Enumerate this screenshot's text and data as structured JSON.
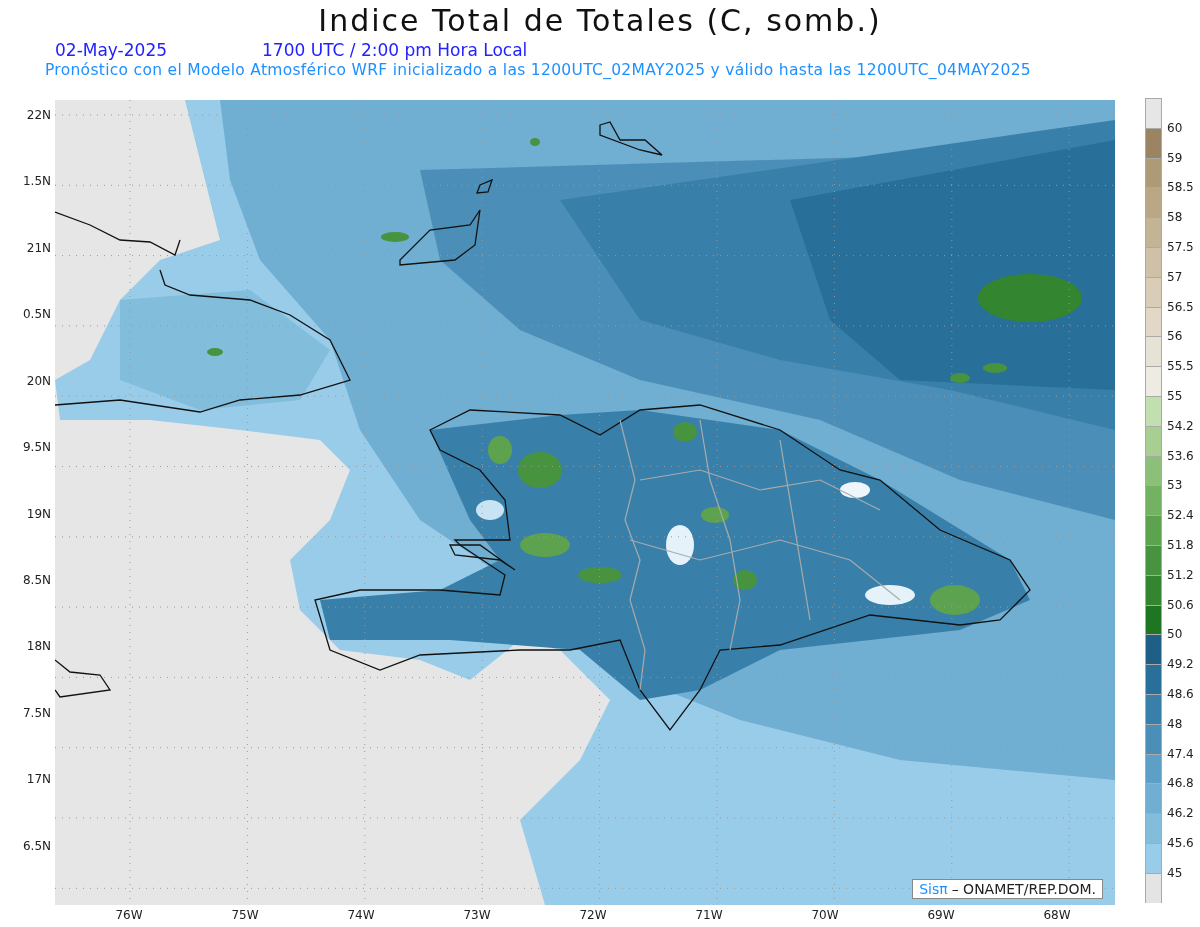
{
  "title": "Indice Total de Totales (C, somb.)",
  "date": "02-May-2025",
  "time": "1700 UTC / 2:00 pm Hora Local",
  "subtitle": "Pronóstico con el Modelo Atmosférico WRF inicializado a las 1200UTC_02MAY2025 y válido hasta las  1200UTC_04MAY2025",
  "lat_labels": [
    "22N",
    "1.5N",
    "21N",
    "0.5N",
    "20N",
    "9.5N",
    "19N",
    "8.5N",
    "18N",
    "7.5N",
    "17N",
    "6.5N"
  ],
  "lon_labels": [
    "76W",
    "75W",
    "74W",
    "73W",
    "72W",
    "71W",
    "70W",
    "69W",
    "68W"
  ],
  "colorbar": {
    "cells": [
      {
        "color": "#e6e6e6",
        "label": "60"
      },
      {
        "color": "#9a8462",
        "label": "59"
      },
      {
        "color": "#ad9a77",
        "label": "58.5"
      },
      {
        "color": "#b9a785",
        "label": "58"
      },
      {
        "color": "#c4b496",
        "label": "57.5"
      },
      {
        "color": "#cfc1a7",
        "label": "57"
      },
      {
        "color": "#d9cdb8",
        "label": "56.5"
      },
      {
        "color": "#e1d8c8",
        "label": "56"
      },
      {
        "color": "#e8e1d5",
        "label": "55.5"
      },
      {
        "color": "#eeebe3",
        "label": "55"
      },
      {
        "color": "#c2dfb0",
        "label": "54.2"
      },
      {
        "color": "#a7cf92",
        "label": "53.6"
      },
      {
        "color": "#8cc079",
        "label": "53"
      },
      {
        "color": "#73b163",
        "label": "52.4"
      },
      {
        "color": "#5ca24f",
        "label": "51.8"
      },
      {
        "color": "#47933f",
        "label": "51.2"
      },
      {
        "color": "#338530",
        "label": "50.6"
      },
      {
        "color": "#1e7522",
        "label": "50"
      },
      {
        "color": "#1f5f86",
        "label": "49.2"
      },
      {
        "color": "#286f99",
        "label": "48.6"
      },
      {
        "color": "#3880aa",
        "label": "48"
      },
      {
        "color": "#4b8fb8",
        "label": "47.4"
      },
      {
        "color": "#5d9fc6",
        "label": "46.8"
      },
      {
        "color": "#70aed2",
        "label": "46.2"
      },
      {
        "color": "#83bddc",
        "label": "45.6"
      },
      {
        "color": "#98cce9",
        "label": "45"
      },
      {
        "color": "#e4e4e4"
      }
    ]
  },
  "credit": {
    "logo": "Sisπ",
    "text": "– ONAMET/REP.DOM."
  }
}
